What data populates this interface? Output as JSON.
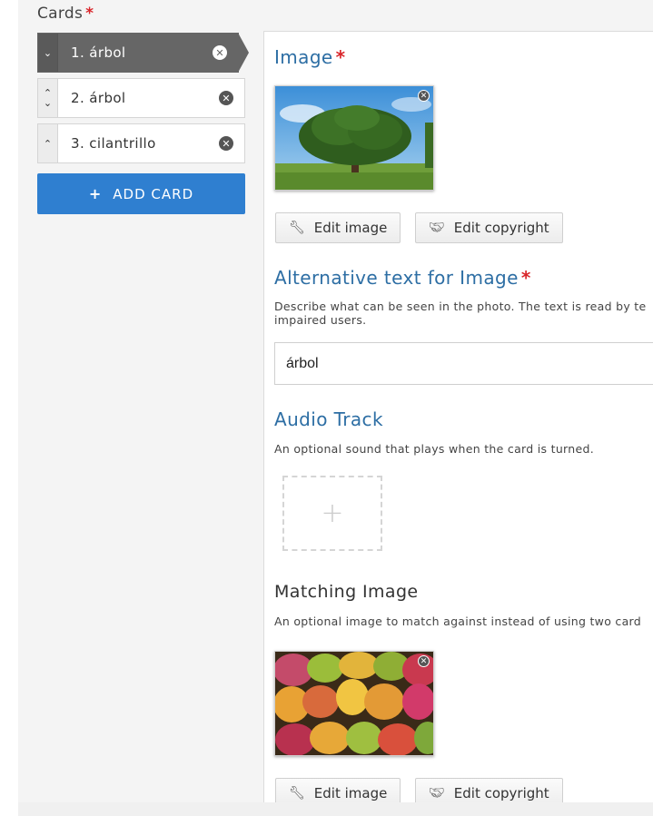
{
  "cards_section": {
    "label": "Cards",
    "required_mark": "*",
    "items": [
      {
        "label": "1. árbol",
        "remove": "✕"
      },
      {
        "label": "2. árbol",
        "remove": "✕"
      },
      {
        "label": "3. cilantrillo",
        "remove": "✕"
      }
    ],
    "add_button": {
      "icon": "+",
      "label": "ADD CARD"
    }
  },
  "image_field": {
    "title": "Image",
    "required_mark": "*",
    "edit_image_label": "Edit image",
    "edit_copyright_label": "Edit copyright"
  },
  "alt_text_field": {
    "title": "Alternative text for Image",
    "required_mark": "*",
    "description_line1": "Describe what can be seen in the photo. The text is read by te",
    "description_line2": "impaired users.",
    "value": "árbol"
  },
  "audio_field": {
    "title": "Audio Track",
    "description": "An optional sound that plays when the card is turned.",
    "add_icon": "+"
  },
  "matching_image_field": {
    "title": "Matching Image",
    "description": "An optional image to match against instead of using two card",
    "edit_image_label": "Edit image",
    "edit_copyright_label": "Edit copyright"
  },
  "colors": {
    "accent_blue": "#2f7fd0",
    "title_blue": "#2d6ea4",
    "active_card": "#666666",
    "required_red": "#d9262b"
  }
}
